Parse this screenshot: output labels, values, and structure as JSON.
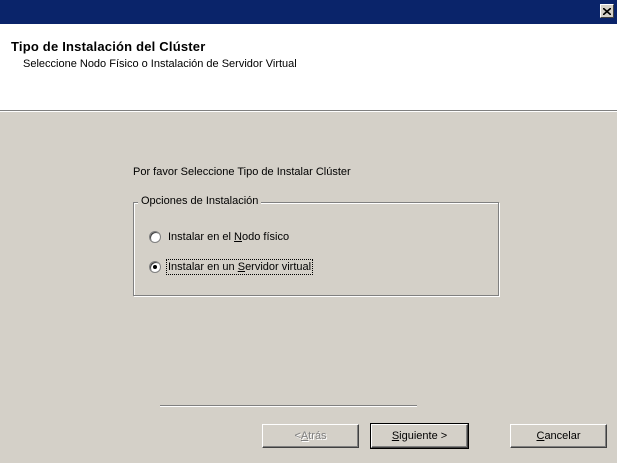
{
  "window": {
    "title": "",
    "close_icon": "close-x-icon"
  },
  "header": {
    "title": "Tipo de Instalación del Clúster",
    "subtitle": "Seleccione Nodo Físico o Instalación de Servidor Virtual"
  },
  "main": {
    "prompt": "Por favor Seleccione Tipo de Instalar Clúster",
    "group_label": "Opciones de Instalación",
    "options": [
      {
        "pre": "Instalar en el ",
        "accel": "N",
        "post": "odo físico",
        "checked": false
      },
      {
        "pre": "Instalar en un ",
        "accel": "S",
        "post": "ervidor virtual",
        "checked": true
      }
    ]
  },
  "buttons": {
    "back": {
      "pre": "< ",
      "accel": "A",
      "post": "trás",
      "enabled": false
    },
    "next": {
      "pre": "",
      "accel": "S",
      "post": "iguiente >",
      "enabled": true
    },
    "cancel": {
      "pre": "",
      "accel": "C",
      "post": "ancelar",
      "enabled": true
    }
  },
  "colors": {
    "titlebar": "#0a246a",
    "dialog_bg": "#d4d0c8",
    "header_bg": "#ffffff",
    "disabled_text": "#808080"
  }
}
